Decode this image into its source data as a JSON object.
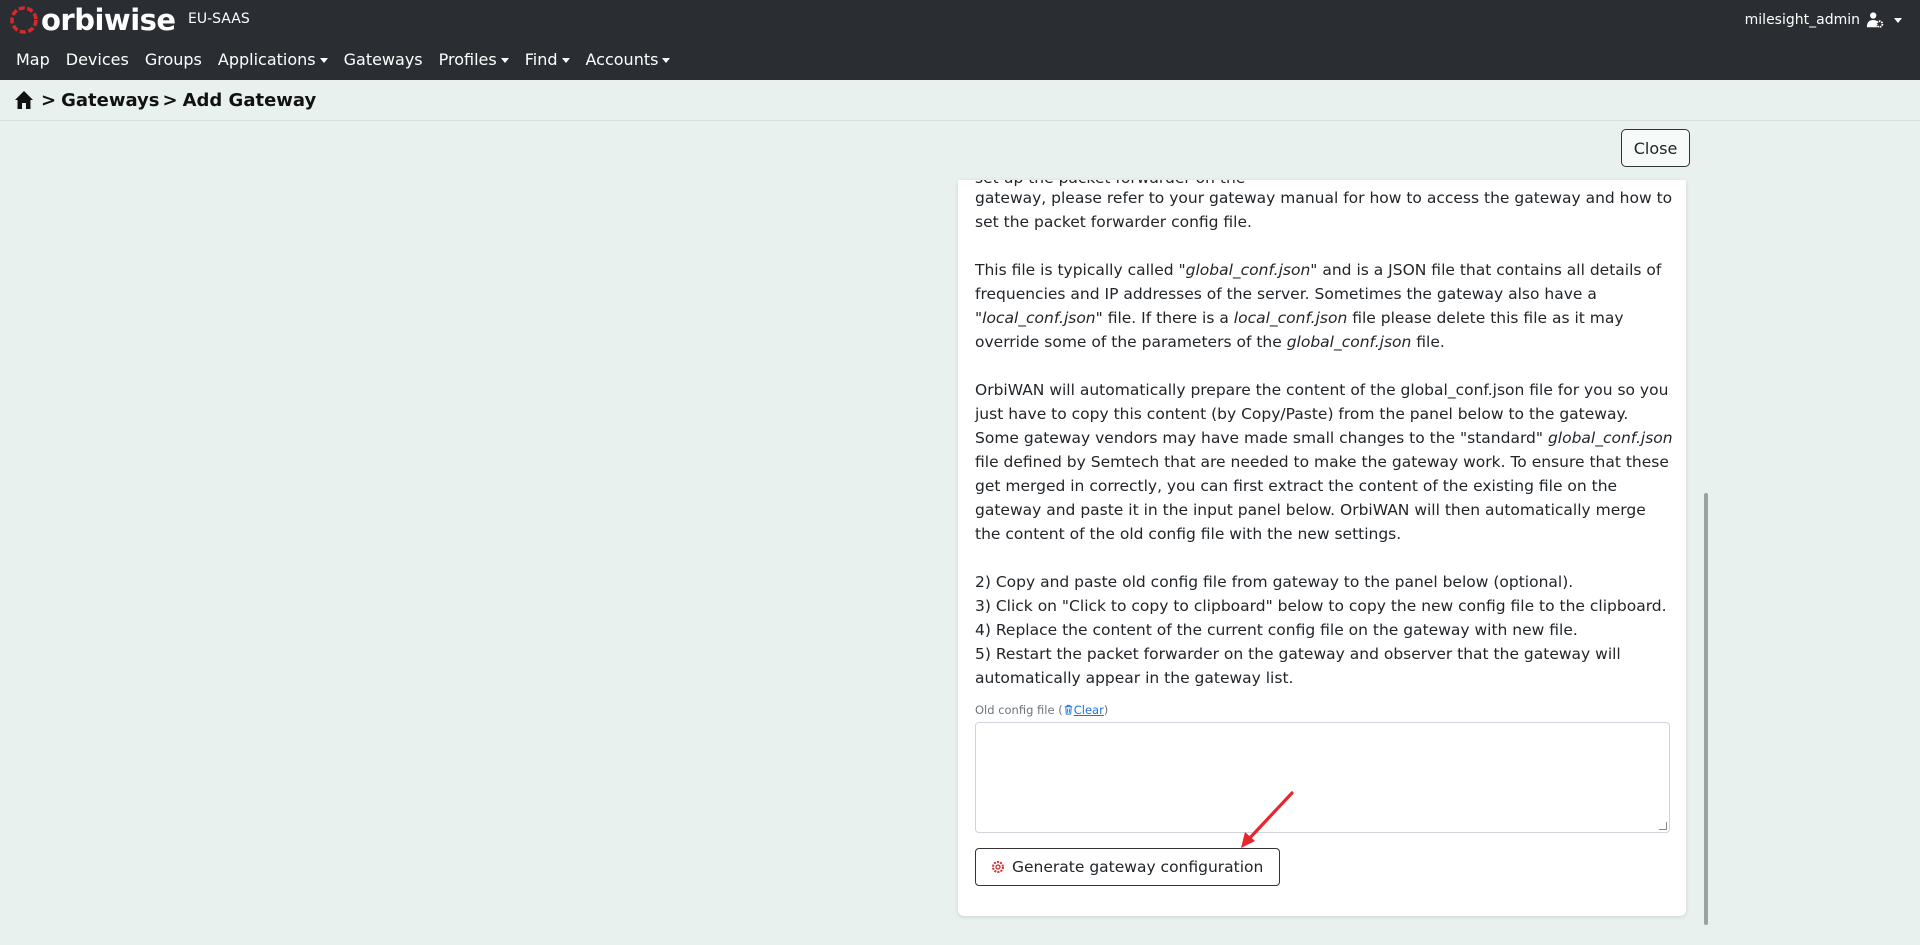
{
  "header": {
    "logo_text": "orbiwise",
    "tenant": "EU-SAAS",
    "username": "milesight_admin",
    "nav": [
      "Map",
      "Devices",
      "Groups",
      "Applications",
      "Gateways",
      "Profiles",
      "Find",
      "Accounts"
    ],
    "nav_has_dropdown": [
      false,
      false,
      false,
      true,
      false,
      true,
      true,
      true
    ]
  },
  "breadcrumb": {
    "items": [
      "Gateways",
      "Add Gateway"
    ],
    "separator": ">"
  },
  "close_button": "Close",
  "instructions": {
    "clipped_line": "set up the packet forwarder on the",
    "p1_line1": "gateway, please refer to your gateway manual for how to access the gateway and how to",
    "p1_line2": "set the packet forwarder config file.",
    "p2_a": "This file is typically called \"",
    "p2_b": "global_conf.json",
    "p2_c": "\" and is a JSON file that contains all details of frequencies and IP addresses of the server. Sometimes the gateway also have a \"",
    "p2_d": "local_conf.json",
    "p2_e": "\" file. If there is a ",
    "p2_f": "local_conf.json",
    "p2_g": " file please delete this file as it may override some of the parameters of the ",
    "p2_h": "global_conf.json",
    "p2_i": " file.",
    "p3_a": "OrbiWAN will automatically prepare the content of the global_conf.json file for you so you just have to copy this content (by Copy/Paste) from the panel below to the gateway. Some gateway vendors may have made small changes to the \"standard\" ",
    "p3_b": "global_conf.json",
    "p3_c": " file defined by Semtech that are needed to make the gateway work. To ensure that these get merged in correctly, you can first extract the content of the existing file on the gateway and paste it in the input panel below. OrbiWAN will then automatically merge the content of the old config file with the new settings.",
    "steps": [
      "2) Copy and paste old config file from gateway to the panel below (optional).",
      "3) Click on \"Click to copy to clipboard\" below to copy the new config file to the clipboard.",
      "4) Replace the content of the current config file on the gateway with new file.",
      "5) Restart the packet forwarder on the gateway and observer that the gateway will automatically appear in the gateway list."
    ]
  },
  "old_config": {
    "label": "Old config file (",
    "clear_label": "Clear",
    "label_end": ")",
    "value": ""
  },
  "generate_button": "Generate gateway configuration",
  "colors": {
    "topbar": "#2a2e33",
    "page_bg": "#e9f1ef",
    "brand_red": "#d42a2a",
    "link_blue": "#1a73e8",
    "arrow_red": "#e8262b"
  }
}
